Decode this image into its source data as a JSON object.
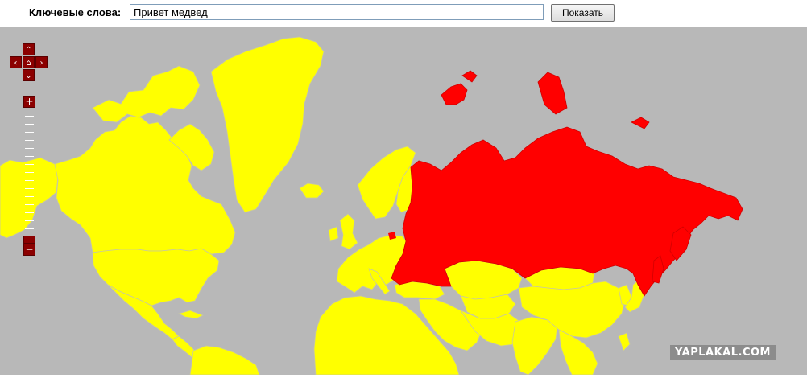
{
  "search": {
    "label": "Ключевые слова:",
    "value": "Привет медвед",
    "button_label": "Показать"
  },
  "map": {
    "ocean_color": "#b8b8b8",
    "default_country_color": "#ffff00",
    "highlight_color": "#ff0000",
    "border_color": "#c8c8a0",
    "highlighted_country": "Russia"
  },
  "map_controls": {
    "pan_up_icon": "chevron-up-icon",
    "pan_down_icon": "chevron-down-icon",
    "pan_left_icon": "chevron-left-icon",
    "pan_right_icon": "chevron-right-icon",
    "home_icon": "home-icon",
    "zoom_in_symbol": "+",
    "zoom_out_symbol": "−"
  },
  "watermark": {
    "text": "YAPLAKAL.COM"
  }
}
